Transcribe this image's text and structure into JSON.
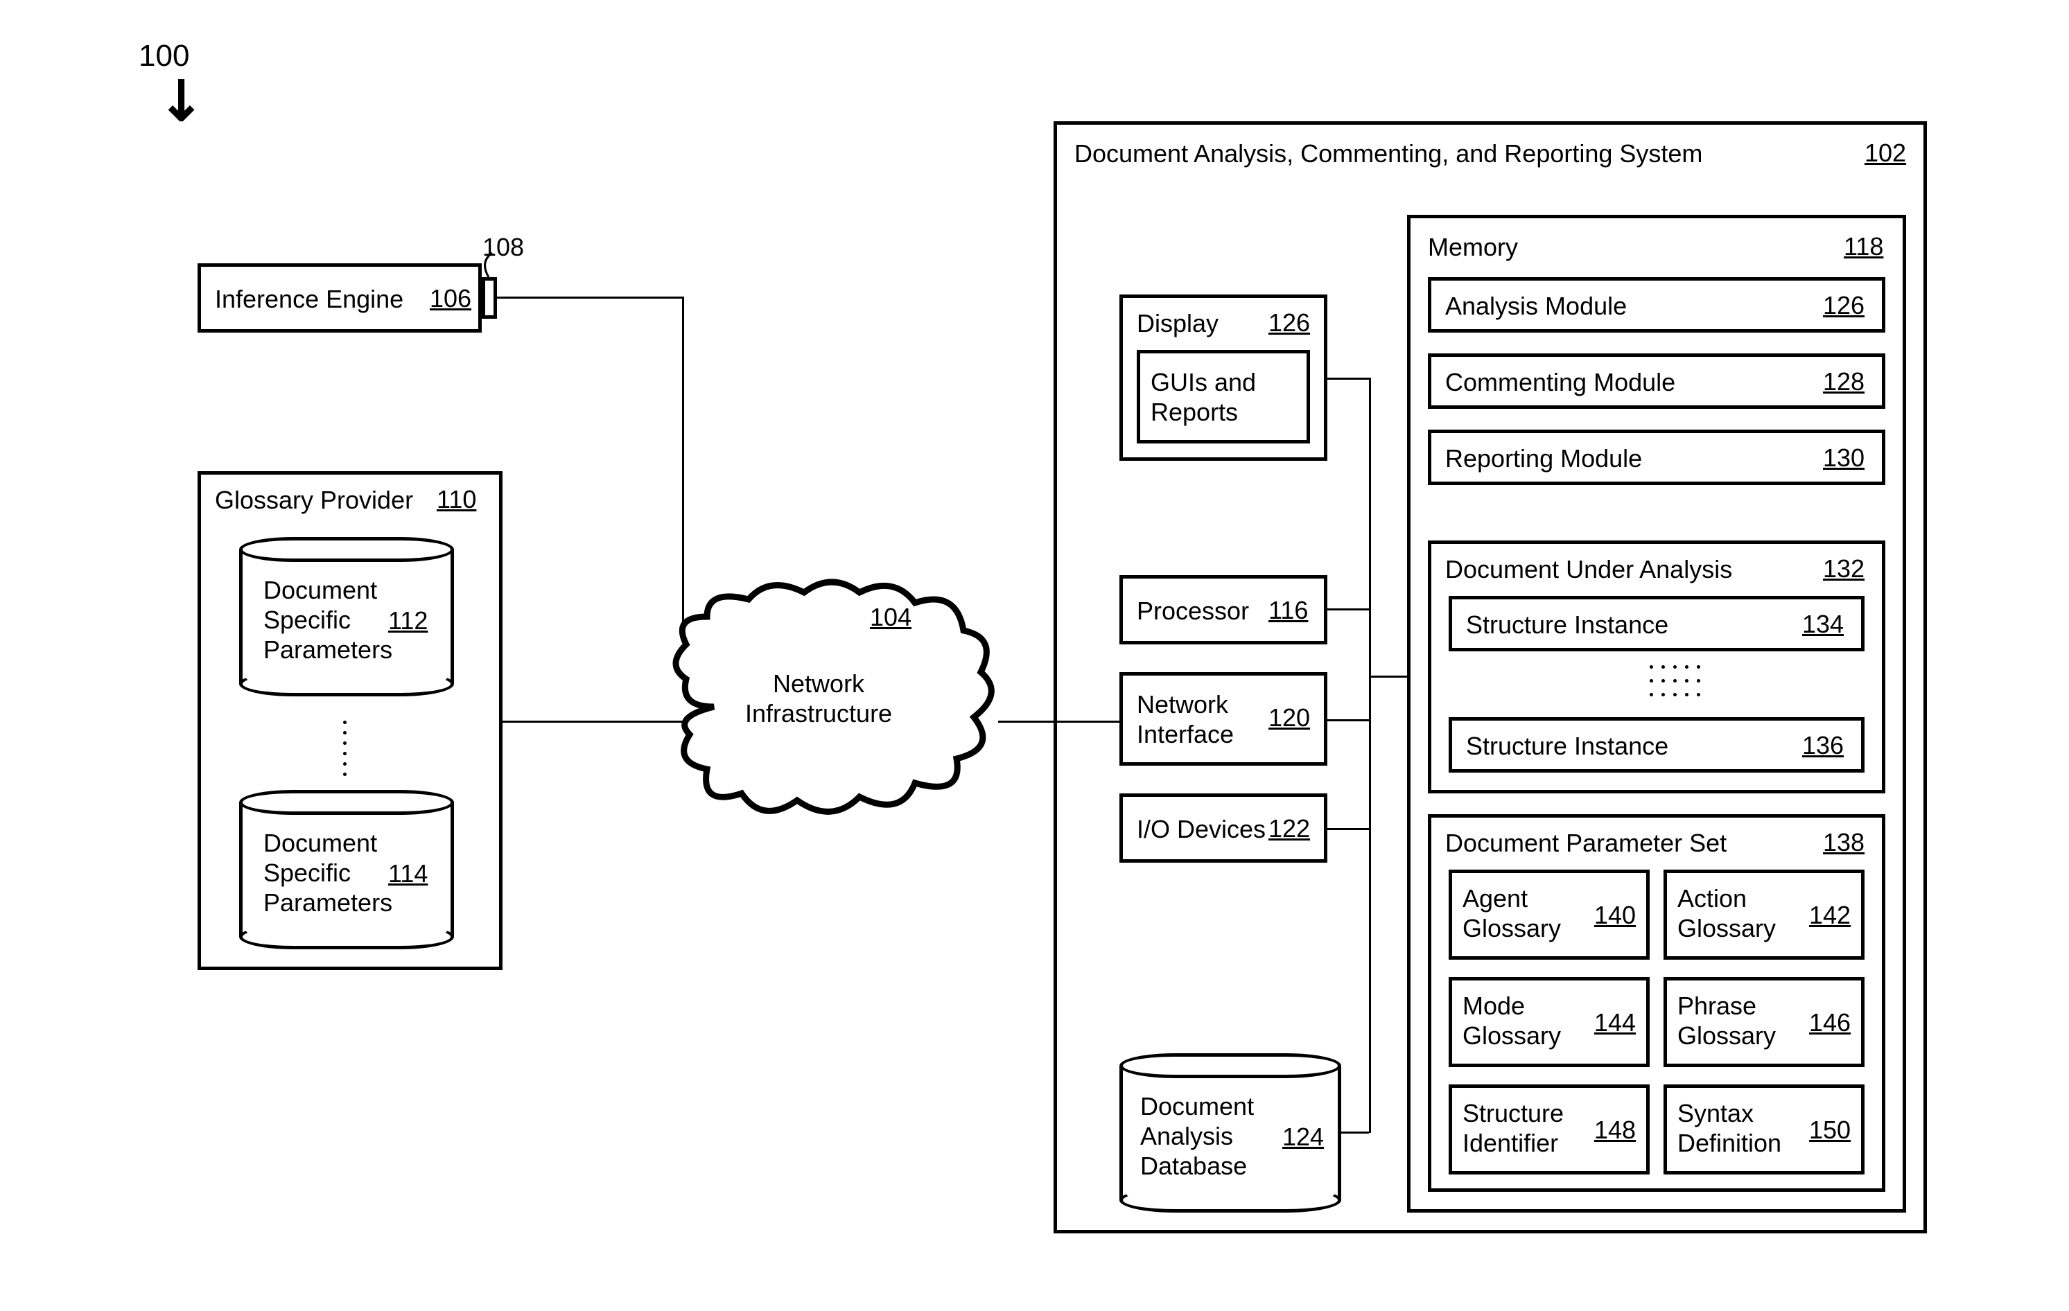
{
  "fig_ref": "100",
  "inference_engine": {
    "label": "Inference Engine",
    "ref": "106",
    "port_ref": "108"
  },
  "glossary_provider": {
    "title": "Glossary Provider",
    "ref": "110",
    "db1": {
      "label": "Document\nSpecific\nParameters",
      "ref": "112"
    },
    "db2": {
      "label": "Document\nSpecific\nParameters",
      "ref": "114"
    }
  },
  "network": {
    "label": "Network\nInfrastructure",
    "ref": "104"
  },
  "system": {
    "title": "Document Analysis, Commenting, and Reporting System",
    "ref": "102",
    "display": {
      "label": "Display",
      "ref": "126",
      "inner": "GUIs and\nReports"
    },
    "processor": {
      "label": "Processor",
      "ref": "116"
    },
    "net_iface": {
      "label": "Network\nInterface",
      "ref": "120"
    },
    "io_devices": {
      "label": "I/O Devices",
      "ref": "122"
    },
    "dadb": {
      "label": "Document\nAnalysis\nDatabase",
      "ref": "124"
    },
    "memory": {
      "title": "Memory",
      "ref": "118",
      "analysis": {
        "label": "Analysis Module",
        "ref": "126"
      },
      "commenting": {
        "label": "Commenting Module",
        "ref": "128"
      },
      "reporting": {
        "label": "Reporting Module",
        "ref": "130"
      },
      "dua": {
        "title": "Document Under Analysis",
        "ref": "132",
        "si1": {
          "label": "Structure Instance",
          "ref": "134"
        },
        "si2": {
          "label": "Structure Instance",
          "ref": "136"
        }
      },
      "dps": {
        "title": "Document Parameter Set",
        "ref": "138",
        "agent": {
          "label": "Agent\nGlossary",
          "ref": "140"
        },
        "action": {
          "label": "Action\nGlossary",
          "ref": "142"
        },
        "mode": {
          "label": "Mode\nGlossary",
          "ref": "144"
        },
        "phrase": {
          "label": "Phrase\nGlossary",
          "ref": "146"
        },
        "struct": {
          "label": "Structure\nIdentifier",
          "ref": "148"
        },
        "syntax": {
          "label": "Syntax\nDefinition",
          "ref": "150"
        }
      }
    }
  }
}
